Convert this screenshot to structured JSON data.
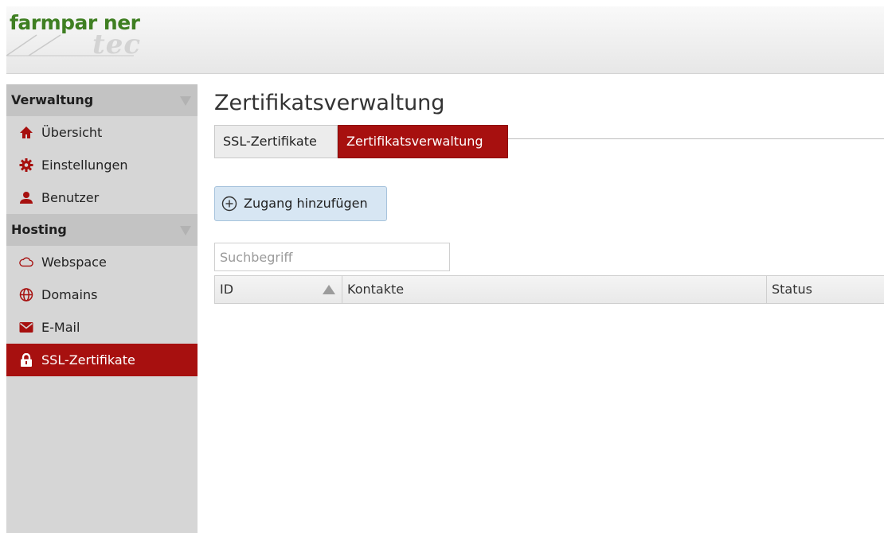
{
  "header": {
    "logo_main": "farmpar ner",
    "logo_sub": "tec"
  },
  "sidebar": {
    "sections": [
      {
        "title": "Verwaltung",
        "items": [
          {
            "label": "Übersicht",
            "icon": "home-icon"
          },
          {
            "label": "Einstellungen",
            "icon": "gear-icon"
          },
          {
            "label": "Benutzer",
            "icon": "user-icon"
          }
        ]
      },
      {
        "title": "Hosting",
        "items": [
          {
            "label": "Webspace",
            "icon": "cloud-icon"
          },
          {
            "label": "Domains",
            "icon": "globe-icon"
          },
          {
            "label": "E-Mail",
            "icon": "mail-icon"
          },
          {
            "label": "SSL-Zertifikate",
            "icon": "lock-icon",
            "active": true
          }
        ]
      }
    ]
  },
  "main": {
    "title": "Zertifikatsverwaltung",
    "tabs": [
      {
        "label": "SSL-Zertifikate",
        "active": false
      },
      {
        "label": "Zertifikatsverwaltung",
        "active": true
      }
    ],
    "add_button": "Zugang hinzufügen",
    "search": {
      "placeholder": "Suchbegriff",
      "value": ""
    },
    "table": {
      "columns": [
        "ID",
        "Kontakte",
        "Status"
      ],
      "rows": []
    }
  },
  "colors": {
    "accent": "#a7100f",
    "logo_green": "#3f7f22",
    "button_bg": "#d7e6f3"
  }
}
